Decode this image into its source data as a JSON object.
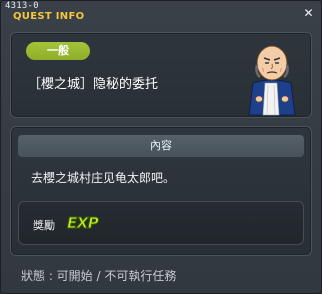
{
  "window": {
    "quest_id": "4313-0",
    "title": "QUEST INFO",
    "close_icon": "close-icon"
  },
  "header": {
    "category": "一般",
    "quest_name": "［櫻之城］隐秘的委托",
    "npc_icon": "npc-portrait"
  },
  "content": {
    "section_title": "內容",
    "description": "去櫻之城村庄见龟太郎吧。"
  },
  "reward": {
    "label": "獎勵",
    "type": "EXP",
    "icon": "exp-icon"
  },
  "status": {
    "label": "狀態 : 可開始 / 不可執行任務"
  },
  "colors": {
    "title_accent": "#f3c63b",
    "badge_green": "#9dbb33",
    "exp_green": "#c6ef2a",
    "panel_bg": "#2c3238"
  }
}
